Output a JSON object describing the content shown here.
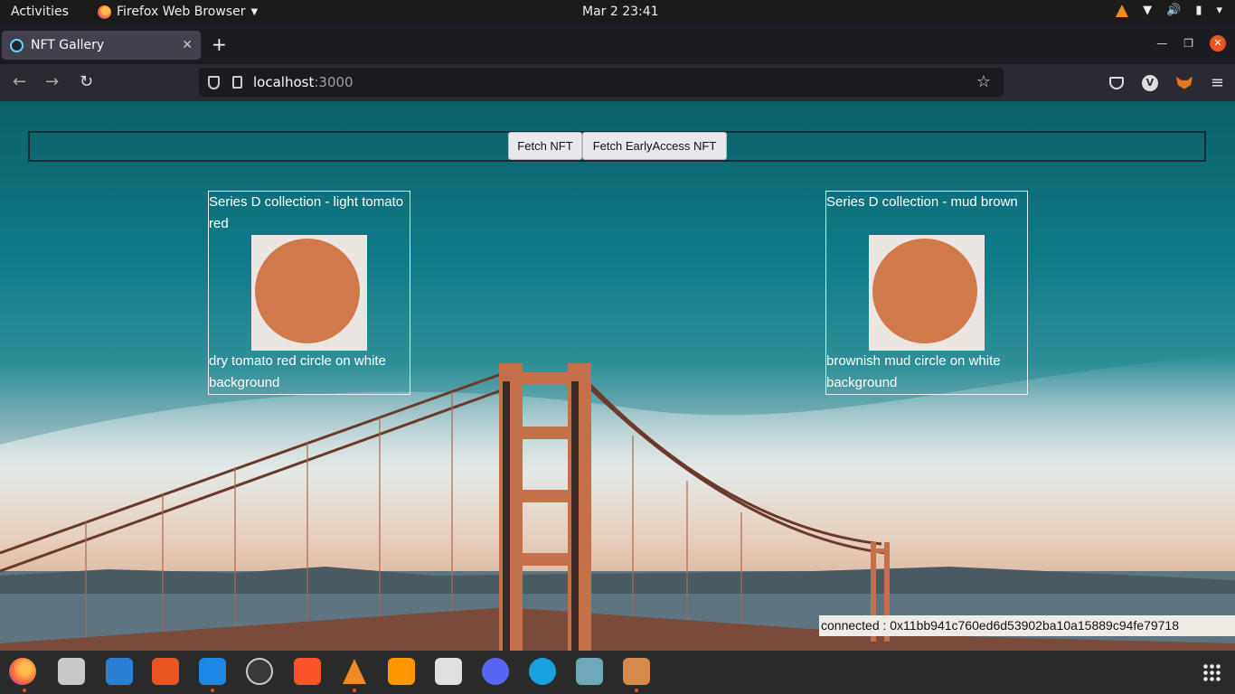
{
  "system": {
    "activities": "Activities",
    "app_name": "Firefox Web Browser",
    "clock": "Mar 2  23:41"
  },
  "browser": {
    "tab_title": "NFT Gallery",
    "url_host": "localhost",
    "url_port": ":3000"
  },
  "page": {
    "buttons": {
      "fetch": "Fetch NFT",
      "fetch_early": "Fetch EarlyAccess NFT"
    },
    "cards": [
      {
        "title": "Series D collection - light tomato red",
        "description": "dry tomato red circle on white background",
        "color": "#d0794a"
      },
      {
        "title": "Series D collection - mud brown",
        "description": "brownish mud circle on white background",
        "color": "#d0794a"
      }
    ],
    "status": "connected : 0x11bb941c760ed6d53902ba10a15889c94fe79718"
  },
  "dock": {
    "items": [
      "firefox-icon",
      "files-icon",
      "writer-icon",
      "software-icon",
      "vscode-icon",
      "obs-icon",
      "brave-icon",
      "vlc-icon",
      "sublime-icon",
      "screenshot-icon",
      "discord-icon",
      "tasks-icon",
      "text-editor-icon",
      "box-icon"
    ]
  }
}
